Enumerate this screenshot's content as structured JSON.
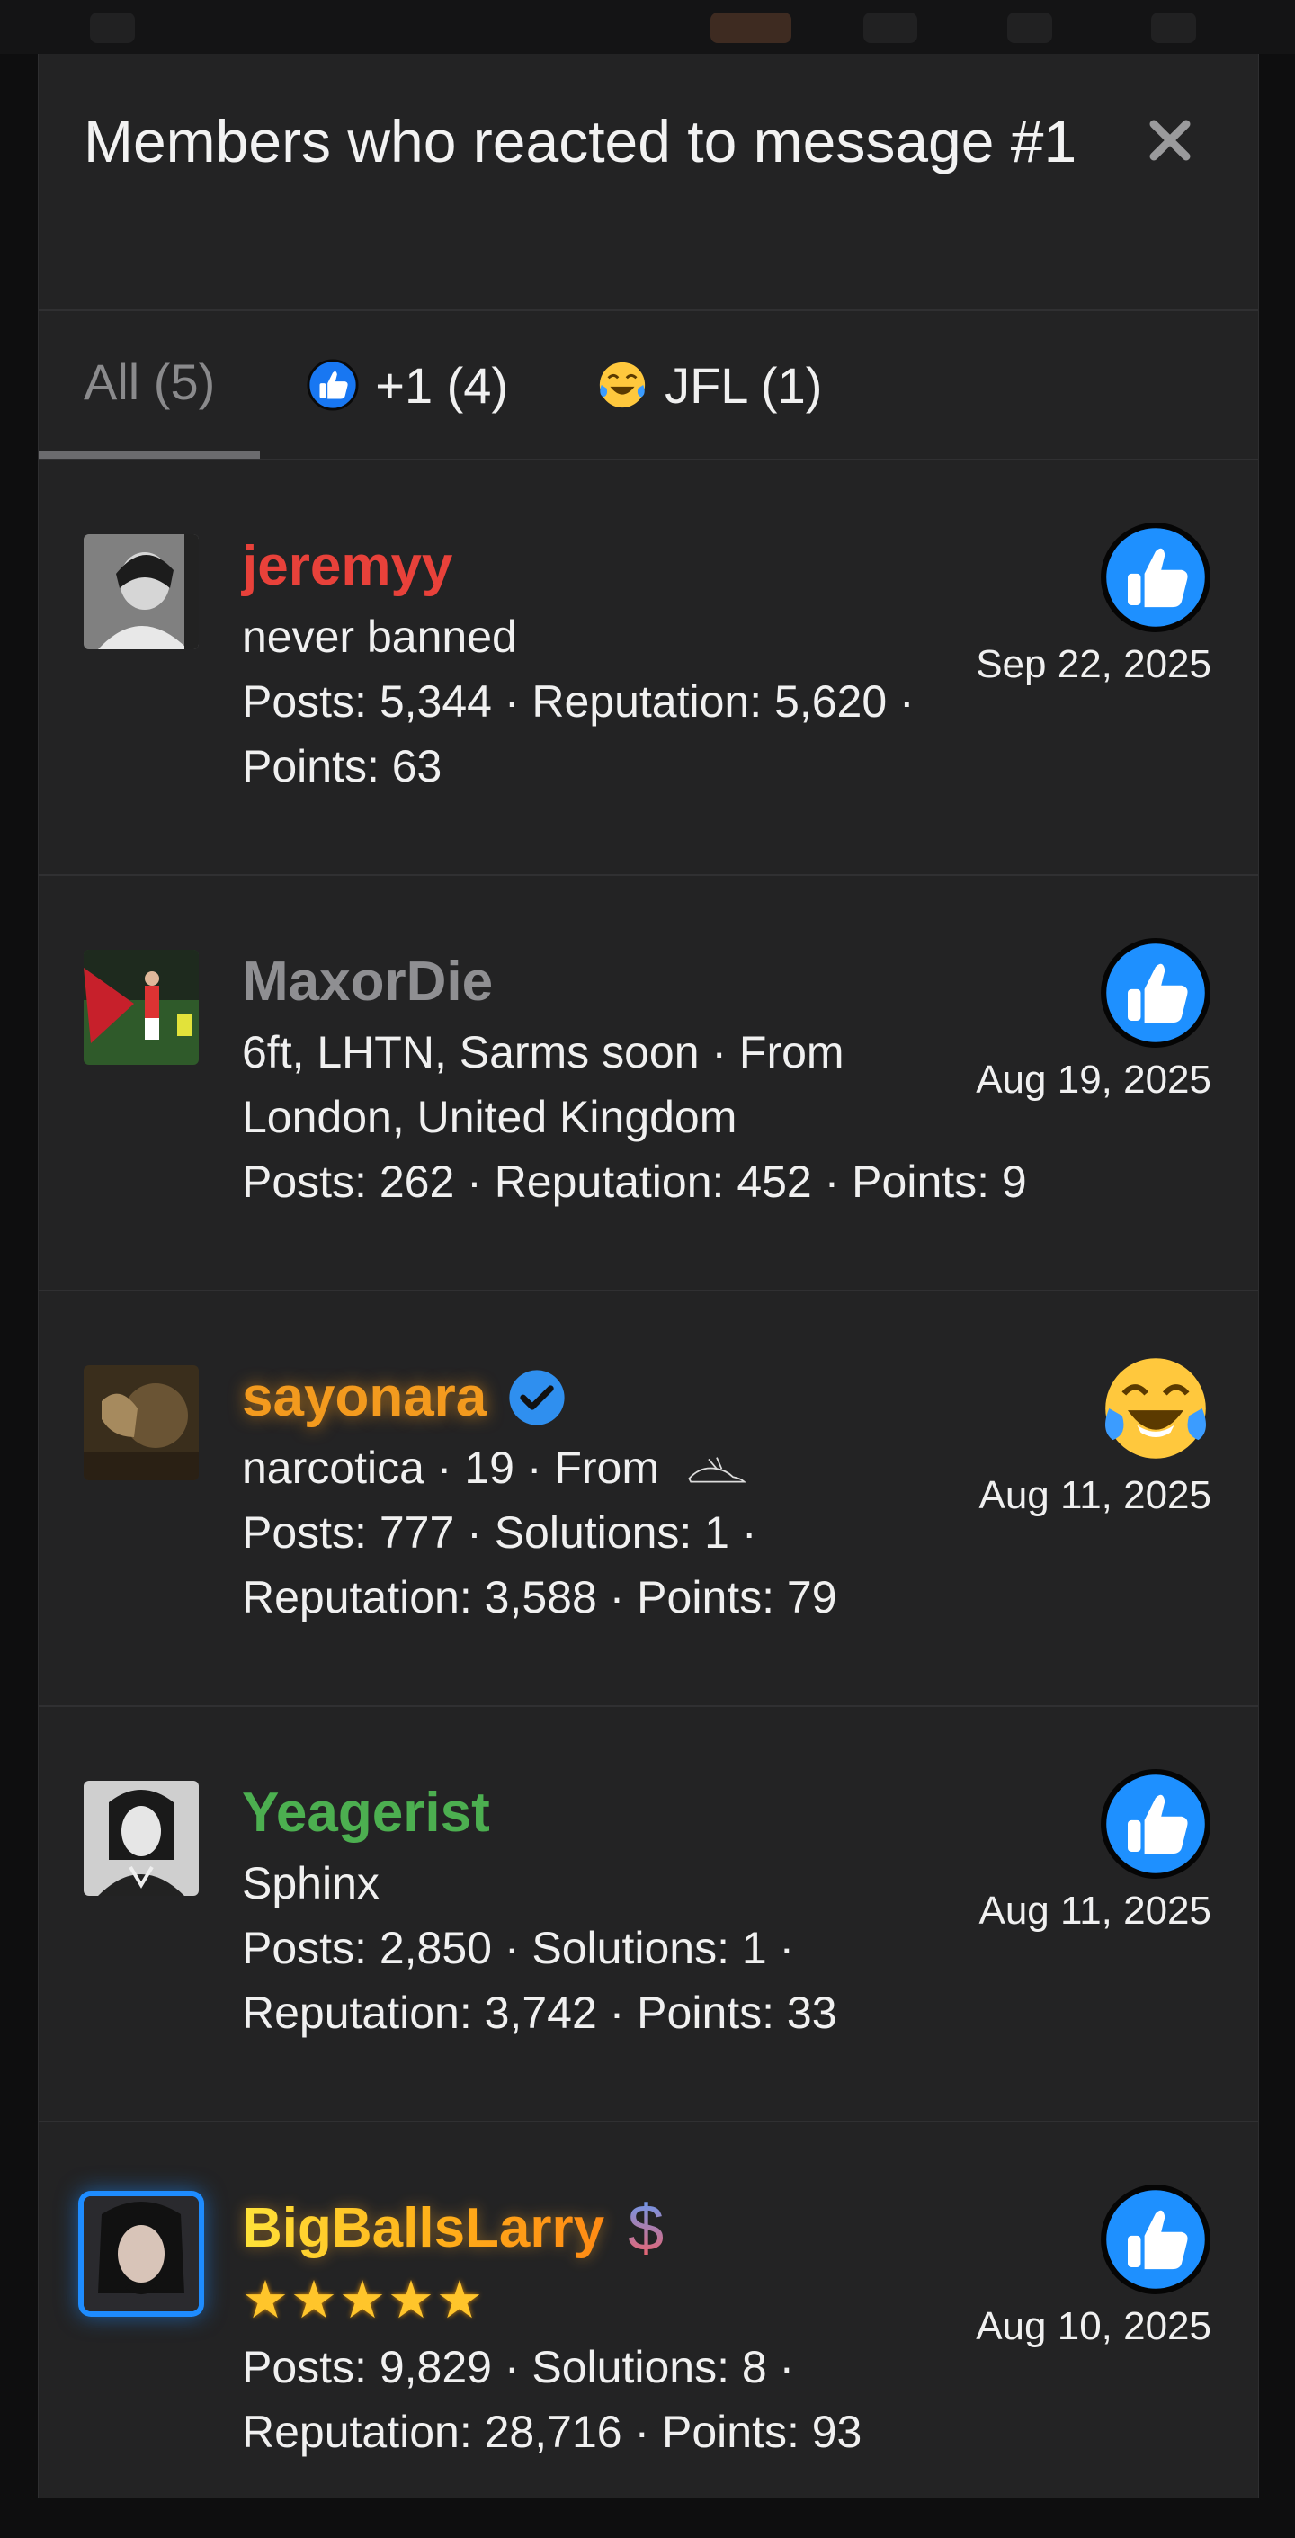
{
  "modal": {
    "title": "Members who reacted to message #1",
    "tabs": [
      {
        "label": "All (5)",
        "icon": "",
        "active": true
      },
      {
        "label": "+1 (4)",
        "icon": "thumbs-up-reaction-icon"
      },
      {
        "label": "JFL (1)",
        "icon": "laughing-crying-emoji-icon"
      }
    ]
  },
  "members": [
    {
      "username": "jeremyy",
      "color": "#e8413a",
      "lines": [
        "never banned",
        "Posts: 5,344 · Reputation: 5,620 ·",
        "Points: 63"
      ],
      "reaction": "thumbs-up-reaction-icon",
      "date": "Sep 22, 2025"
    },
    {
      "username": "MaxorDie",
      "color": "#8f8f92",
      "lines": [
        "6ft, LHTN, Sarms soon · From",
        "London, United Kingdom",
        "Posts: 262 · Reputation: 452 · Points: 9"
      ],
      "reaction": "thumbs-up-reaction-icon",
      "date": "Aug 19, 2025"
    },
    {
      "username": "sayonara",
      "color": "#f39a1e",
      "badge": "verified-badge-icon",
      "lines": [
        "narcotica · 19 · From",
        "Posts: 777 · Solutions: 1 ·",
        "Reputation: 3,588 · Points: 79"
      ],
      "reaction": "laughing-crying-emoji-icon",
      "date": "Aug 11, 2025"
    },
    {
      "username": "Yeagerist",
      "color": "#4caf50",
      "lines": [
        "Sphinx",
        "Posts: 2,850 · Solutions: 1 ·",
        "Reputation: 3,742 · Points: 33"
      ],
      "reaction": "thumbs-up-reaction-icon",
      "date": "Aug 11, 2025"
    },
    {
      "username": "BigBallsLarry",
      "color": "#ffc52b",
      "badge": "dollar-sign-icon",
      "badge_text": "$",
      "stars": "★★★★★",
      "lines": [
        "Posts: 9,829 · Solutions: 8 ·",
        "Reputation: 28,716 · Points: 93"
      ],
      "reaction": "thumbs-up-reaction-icon",
      "date": "Aug 10, 2025"
    }
  ]
}
